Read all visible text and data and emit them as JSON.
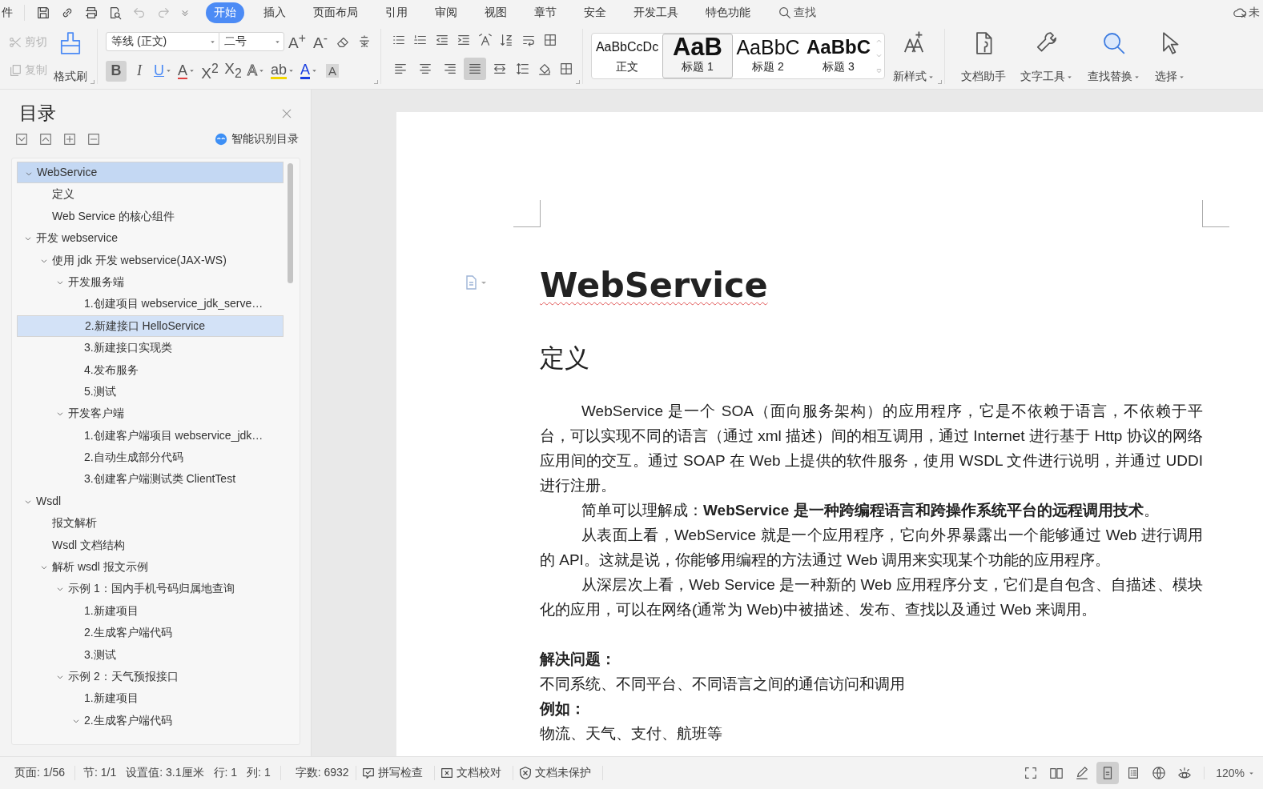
{
  "menu_bar": {
    "file_menu": "件",
    "tabs": [
      {
        "label": "开始",
        "selected": true
      },
      {
        "label": "插入",
        "selected": false
      },
      {
        "label": "页面布局",
        "selected": false
      },
      {
        "label": "引用",
        "selected": false
      },
      {
        "label": "审阅",
        "selected": false
      },
      {
        "label": "视图",
        "selected": false
      },
      {
        "label": "章节",
        "selected": false
      },
      {
        "label": "安全",
        "selected": false
      },
      {
        "label": "开发工具",
        "selected": false
      },
      {
        "label": "特色功能",
        "selected": false
      }
    ],
    "search": "查找",
    "cloud_status": "未"
  },
  "ribbon": {
    "clipboard": [
      {
        "label": "剪切",
        "kind": "cut",
        "disabled": true
      },
      {
        "label": "复制",
        "kind": "copy",
        "disabled": true
      }
    ],
    "format_painter": "格式刷",
    "font_name": "等线 (正文)",
    "font_size": "二号",
    "grow_font": "A$^{+}$",
    "shrink_font": "A$^{-}$",
    "font_buttons": [
      {
        "symbol": "B",
        "kind": "bold",
        "selected": true,
        "dropdown": false
      },
      {
        "symbol": "I",
        "kind": "italic",
        "selected": false,
        "dropdown": false
      },
      {
        "symbol": "U",
        "kind": "underline",
        "selected": false,
        "dropdown": true
      },
      {
        "symbol": "A",
        "kind": "strike",
        "selected": false,
        "dropdown": true
      },
      {
        "symbol": "X$^{2}$",
        "kind": "plain",
        "selected": false,
        "dropdown": false
      },
      {
        "symbol": "X$_{2}$",
        "kind": "plain",
        "selected": false,
        "dropdown": false
      },
      {
        "symbol": "A",
        "kind": "outline",
        "selected": false,
        "dropdown": true
      },
      {
        "symbol": "ab",
        "kind": "highlight",
        "selected": false,
        "dropdown": true
      },
      {
        "symbol": "A",
        "kind": "color",
        "selected": false,
        "dropdown": true
      },
      {
        "symbol": "A",
        "kind": "shade",
        "selected": false,
        "dropdown": false
      }
    ],
    "paragraph_align": [
      {
        "kind": "left",
        "selected": false
      },
      {
        "kind": "center",
        "selected": false
      },
      {
        "kind": "right",
        "selected": false
      },
      {
        "kind": "justify",
        "selected": true
      },
      {
        "kind": "distributed",
        "selected": false
      }
    ],
    "styles": [
      {
        "preview": "AaBbCcDc",
        "label": "正文",
        "kind": "normal",
        "selected": false
      },
      {
        "preview": "AaB",
        "label": "标题 1",
        "kind": "h1",
        "selected": true
      },
      {
        "preview": "AaBbC",
        "label": "标题 2",
        "kind": "h2",
        "selected": false
      },
      {
        "preview": "AaBbC",
        "label": "标题 3",
        "kind": "h3",
        "selected": false
      }
    ],
    "new_style": "新样式",
    "tools": [
      {
        "label": "文档助手",
        "kind": "assistant",
        "dropdown": false
      },
      {
        "label": "文字工具",
        "kind": "wrench",
        "dropdown": true
      },
      {
        "label": "查找替换",
        "kind": "find",
        "dropdown": true
      },
      {
        "label": "选择",
        "kind": "pointer",
        "dropdown": true
      }
    ]
  },
  "sidebar": {
    "title": "目录",
    "smart_toc": "智能识别目录",
    "tree": [
      {
        "label": "WebService",
        "expanded": true,
        "selected": true,
        "children": [
          {
            "label": "定义",
            "selected": false
          },
          {
            "label": "Web Service 的核心组件",
            "selected": false
          }
        ]
      },
      {
        "label": "开发 webservice",
        "expanded": true,
        "selected": false,
        "children": [
          {
            "label": "使用 jdk 开发 webservice(JAX-WS)",
            "expanded": true,
            "selected": false,
            "children": [
              {
                "label": "开发服务端",
                "expanded": true,
                "selected": false,
                "children": [
                  {
                    "label": "1.创建项目 webservice_jdk_serve…",
                    "selected": false
                  },
                  {
                    "label": "2.新建接口 HelloService",
                    "selected": true
                  },
                  {
                    "label": "3.新建接口实现类",
                    "selected": false
                  },
                  {
                    "label": "4.发布服务",
                    "selected": false
                  },
                  {
                    "label": "5.测试",
                    "selected": false
                  }
                ]
              },
              {
                "label": "开发客户端",
                "expanded": true,
                "selected": false,
                "children": [
                  {
                    "label": "1.创建客户端项目 webservice_jdk…",
                    "selected": false
                  },
                  {
                    "label": "2.自动生成部分代码",
                    "selected": false
                  },
                  {
                    "label": "3.创建客户端测试类 ClientTest",
                    "selected": false
                  }
                ]
              }
            ]
          }
        ]
      },
      {
        "label": "Wsdl",
        "expanded": true,
        "selected": false,
        "children": [
          {
            "label": "报文解析",
            "selected": false
          },
          {
            "label": "Wsdl 文档结构",
            "selected": false
          },
          {
            "label": "解析 wsdl 报文示例",
            "expanded": true,
            "selected": false,
            "children": [
              {
                "label": "示例 1：国内手机号码归属地查询",
                "expanded": true,
                "selected": false,
                "children": [
                  {
                    "label": "1.新建项目",
                    "selected": false
                  },
                  {
                    "label": "2.生成客户端代码",
                    "selected": false
                  },
                  {
                    "label": "3.测试",
                    "selected": false
                  }
                ]
              },
              {
                "label": "示例 2：天气预报接口",
                "expanded": true,
                "selected": false,
                "children": [
                  {
                    "label": "1.新建项目",
                    "selected": false
                  },
                  {
                    "label": "2.生成客户端代码",
                    "expanded": true,
                    "selected": false
                  }
                ]
              }
            ]
          }
        ]
      }
    ]
  },
  "document": {
    "title": "WebService",
    "heading": "定义",
    "paragraphs": [
      "WebService 是一个 SOA（面向服务架构）的应用程序，它是不依赖于语言，不依赖于平台，可以实现不同的语言（通过 xml 描述）间的相互调用，通过 Internet 进行基于 Http 协议的网络应用间的交互。通过 SOAP 在 Web 上提供的软件服务，使用 WSDL 文件进行说明，并通过 UDDI 进行注册。",
      "简单可以理解成：**WebService 是一种跨编程语言和跨操作系统平台的远程调用技术**。",
      "从表面上看，WebService 就是一个应用程序，它向外界暴露出一个能够通过 Web 进行调用的 API。这就是说，你能够用编程的方法通过 Web 调用来实现某个功能的应用程序。",
      "从深层次上看，Web Service 是一种新的 Web 应用程序分支，它们是自包含、自描述、模块化的应用，可以在网络(通常为 Web)中被描述、发布、查找以及通过 Web 来调用。"
    ],
    "sections": [
      {
        "label": "解决问题：",
        "text": "不同系统、不同平台、不同语言之间的通信访问和调用"
      },
      {
        "label": "例如：",
        "text": "物流、天气、支付、航班等"
      }
    ]
  },
  "status_bar": {
    "items": [
      "页面: 1/56",
      "节: 1/1",
      "设置值: 3.1厘米",
      "行: 1",
      "列: 1",
      "字数: 6932"
    ],
    "tools": [
      {
        "label": "拼写检查",
        "kind": "spell"
      },
      {
        "label": "文档校对",
        "kind": "proof"
      },
      {
        "label": "文档未保护",
        "kind": "shield"
      }
    ],
    "view_modes": [
      {
        "kind": "fullscreen",
        "selected": false
      },
      {
        "kind": "reading",
        "selected": false
      },
      {
        "kind": "pen",
        "selected": false
      },
      {
        "kind": "page",
        "selected": true
      },
      {
        "kind": "outline",
        "selected": false
      },
      {
        "kind": "web",
        "selected": false
      },
      {
        "kind": "eye",
        "selected": false
      }
    ],
    "zoom": "120%"
  }
}
